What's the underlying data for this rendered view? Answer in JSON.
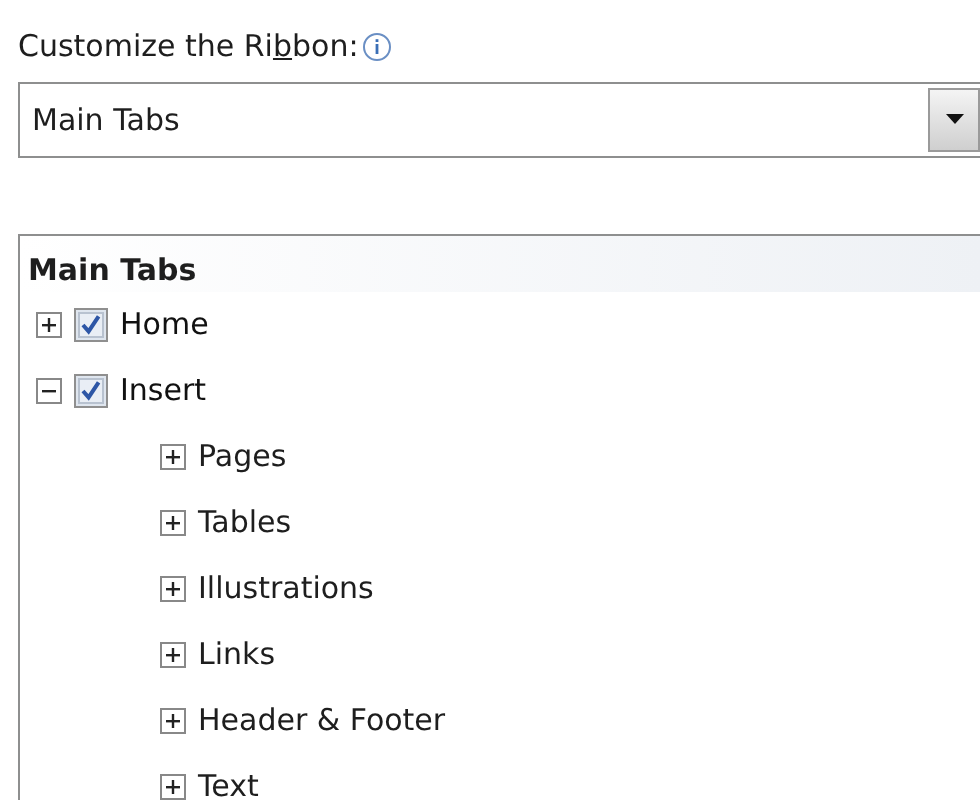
{
  "label": {
    "before_key": "Customize the Ri",
    "access_key": "b",
    "after_key": "bon:"
  },
  "dropdown": {
    "value": "Main Tabs"
  },
  "tree": {
    "header": "Main Tabs",
    "nodes": [
      {
        "label": "Home",
        "kind": "tab",
        "checked": true,
        "expanded": false
      },
      {
        "label": "Insert",
        "kind": "tab",
        "checked": true,
        "expanded": true,
        "children": [
          {
            "label": "Pages",
            "kind": "group",
            "expanded": false
          },
          {
            "label": "Tables",
            "kind": "group",
            "expanded": false
          },
          {
            "label": "Illustrations",
            "kind": "group",
            "expanded": false
          },
          {
            "label": "Links",
            "kind": "group",
            "expanded": false
          },
          {
            "label": "Header & Footer",
            "kind": "group",
            "expanded": false
          },
          {
            "label": "Text",
            "kind": "group",
            "expanded": false
          }
        ]
      }
    ]
  }
}
